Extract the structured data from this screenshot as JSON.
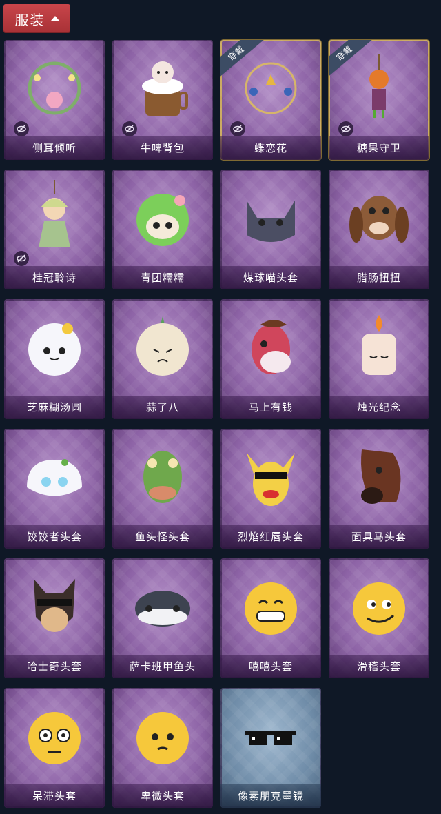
{
  "header": {
    "title": "服装"
  },
  "items": [
    {
      "label": "侧耳倾听",
      "icon": "flower-wreath-icon",
      "equipped": false,
      "hidden": true
    },
    {
      "label": "牛啤背包",
      "icon": "cow-mug-backpack-icon",
      "equipped": false,
      "hidden": true
    },
    {
      "label": "蝶恋花",
      "icon": "butterfly-bell-wreath-icon",
      "equipped": true,
      "hidden": true
    },
    {
      "label": "糖果守卫",
      "icon": "pumpkin-scarecrow-icon",
      "equipped": true,
      "hidden": true
    },
    {
      "label": "桂冠聆诗",
      "icon": "doll-ornament-icon",
      "equipped": false,
      "hidden": true
    },
    {
      "label": "青团糯糯",
      "icon": "green-dumpling-head-icon",
      "equipped": false,
      "hidden": false
    },
    {
      "label": "煤球喵头套",
      "icon": "black-cat-head-icon",
      "equipped": false,
      "hidden": false
    },
    {
      "label": "腊肠扭扭",
      "icon": "dachshund-head-icon",
      "equipped": false,
      "hidden": false
    },
    {
      "label": "芝麻糊汤圆",
      "icon": "rice-ball-head-icon",
      "equipped": false,
      "hidden": false
    },
    {
      "label": "蒜了八",
      "icon": "garlic-head-icon",
      "equipped": false,
      "hidden": false
    },
    {
      "label": "马上有钱",
      "icon": "red-horse-head-icon",
      "equipped": false,
      "hidden": false
    },
    {
      "label": "烛光纪念",
      "icon": "candle-head-icon",
      "equipped": false,
      "hidden": false
    },
    {
      "label": "饺饺者头套",
      "icon": "dumpling-head-icon",
      "equipped": false,
      "hidden": false
    },
    {
      "label": "鱼头怪头套",
      "icon": "fish-head-icon",
      "equipped": false,
      "hidden": false
    },
    {
      "label": "烈焰红唇头套",
      "icon": "yellow-mouse-head-icon",
      "equipped": false,
      "hidden": false
    },
    {
      "label": "面具马头套",
      "icon": "horse-mask-icon",
      "equipped": false,
      "hidden": false
    },
    {
      "label": "哈士奇头套",
      "icon": "husky-head-icon",
      "equipped": false,
      "hidden": false
    },
    {
      "label": "萨卡班甲鱼头",
      "icon": "sacabambaspis-head-icon",
      "equipped": false,
      "hidden": false
    },
    {
      "label": "嘻嘻头套",
      "icon": "grin-emoji-head-icon",
      "equipped": false,
      "hidden": false
    },
    {
      "label": "滑稽头套",
      "icon": "smirk-emoji-head-icon",
      "equipped": false,
      "hidden": false
    },
    {
      "label": "呆滞头套",
      "icon": "flushed-emoji-head-icon",
      "equipped": false,
      "hidden": false
    },
    {
      "label": "卑微头套",
      "icon": "pleading-emoji-head-icon",
      "equipped": false,
      "hidden": false
    },
    {
      "label": "像素朋克墨镜",
      "icon": "pixel-sunglasses-icon",
      "equipped": false,
      "hidden": false,
      "frost": true
    }
  ],
  "badges": {
    "equipped_text": "穿戴"
  },
  "colors": {
    "header_bg": "#b83a3f",
    "card_purple": "#8d63a6",
    "card_frost": "#6f8ca8",
    "equipped_border": "#c9a85c",
    "page_bg": "#0f1826"
  }
}
